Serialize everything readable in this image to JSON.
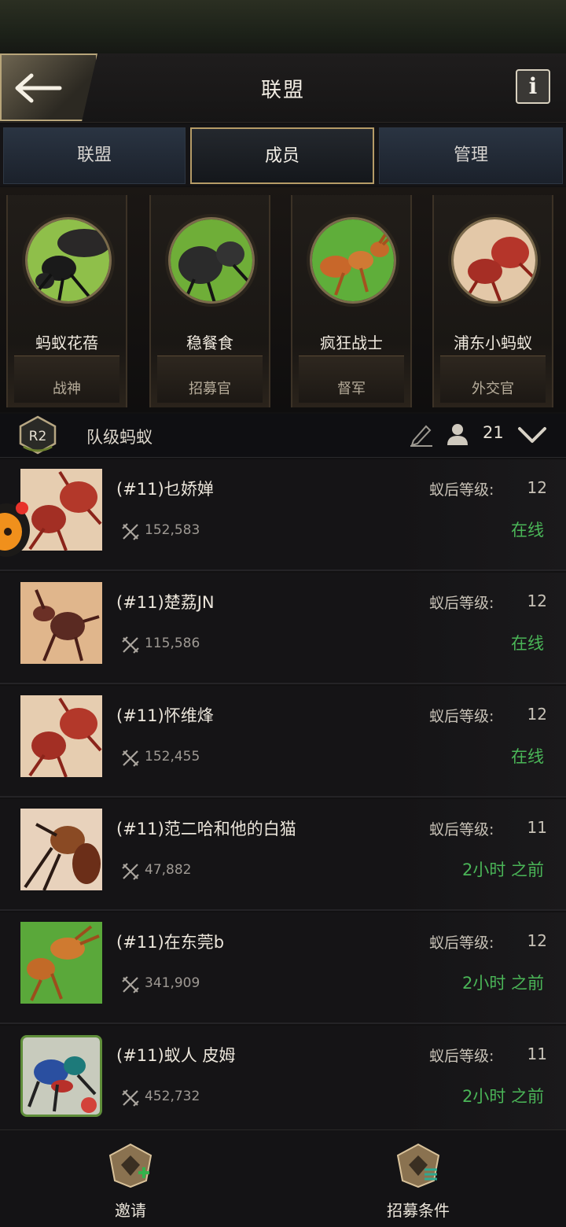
{
  "header": {
    "title": "联盟",
    "back_icon": "arrow-left-icon",
    "info_label": "i"
  },
  "tabs": [
    {
      "label": "联盟",
      "active": false
    },
    {
      "label": "成员",
      "active": true
    },
    {
      "label": "管理",
      "active": false
    }
  ],
  "officers": [
    {
      "name": "蚂蚁花蓓",
      "role": "战神"
    },
    {
      "name": "稳餐食",
      "role": "招募官"
    },
    {
      "name": "疯狂战士",
      "role": "督军"
    },
    {
      "name": "浦东小蚂蚁",
      "role": "外交官"
    }
  ],
  "rank": {
    "badge": "R2",
    "name": "队级蚂蚁",
    "count": "21"
  },
  "members": [
    {
      "name": "(#11)乜娇婵",
      "power": "152,583",
      "level_label": "蚁后等级:",
      "level": "12",
      "status": "在线"
    },
    {
      "name": "(#11)楚荔JN",
      "power": "115,586",
      "level_label": "蚁后等级:",
      "level": "12",
      "status": "在线"
    },
    {
      "name": "(#11)怀维烽",
      "power": "152,455",
      "level_label": "蚁后等级:",
      "level": "12",
      "status": "在线"
    },
    {
      "name": "(#11)范二哈和他的白猫",
      "power": "47,882",
      "level_label": "蚁后等级:",
      "level": "11",
      "status": "2小时 之前"
    },
    {
      "name": "(#11)在东莞b",
      "power": "341,909",
      "level_label": "蚁后等级:",
      "level": "12",
      "status": "2小时 之前"
    },
    {
      "name": "(#11)蚁人 皮姆",
      "power": "452,732",
      "level_label": "蚁后等级:",
      "level": "11",
      "status": "2小时 之前"
    }
  ],
  "bottom": {
    "invite_label": "邀请",
    "recruit_label": "招募条件"
  },
  "colors": {
    "accent_gold": "#b59b67",
    "online_green": "#4ab557",
    "tab_blue": "#2a3442"
  }
}
